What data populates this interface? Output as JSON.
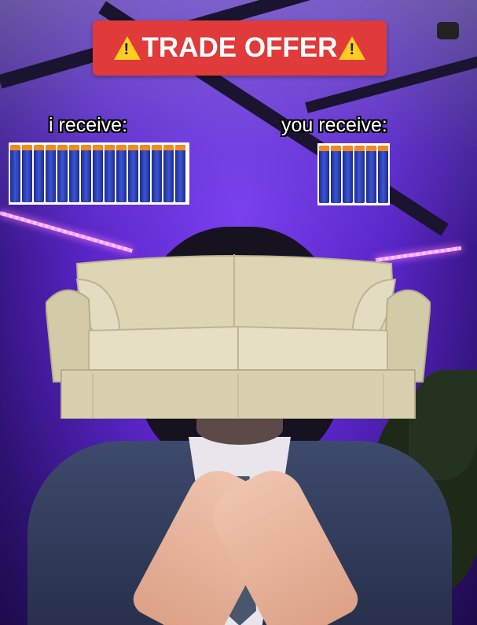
{
  "banner": {
    "title": "TRADE OFFER",
    "icon": "warning-icon"
  },
  "left_side": {
    "label": "i receive:",
    "item": "foam-darts",
    "count": 15
  },
  "right_side": {
    "label": "you receive:",
    "item": "foam-darts",
    "count": 6
  },
  "center_object": "couch",
  "colors": {
    "banner": "#e03a3a",
    "background": "#6a30e0",
    "dart_body": "#2f45c0",
    "dart_tip": "#f28a1d",
    "couch": "#d8d0ae"
  }
}
